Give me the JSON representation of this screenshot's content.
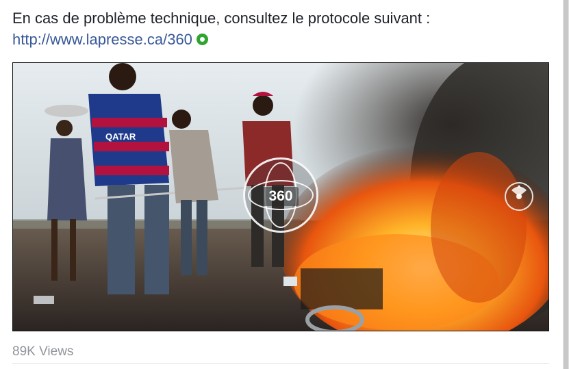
{
  "post": {
    "text_line1": "En cas de problème technique, consultez le protocole suivant :",
    "link": "http://www.lapresse.ca/360",
    "status_icon": "green-ring-icon"
  },
  "video": {
    "badge_label": "360",
    "compass_icon": "360-compass-icon",
    "shirt_text": "QATAR"
  },
  "footer": {
    "views": "89K Views"
  },
  "colors": {
    "link": "#385898",
    "text": "#1d2129",
    "muted": "#90949c",
    "ok_green": "#2ea52e"
  }
}
